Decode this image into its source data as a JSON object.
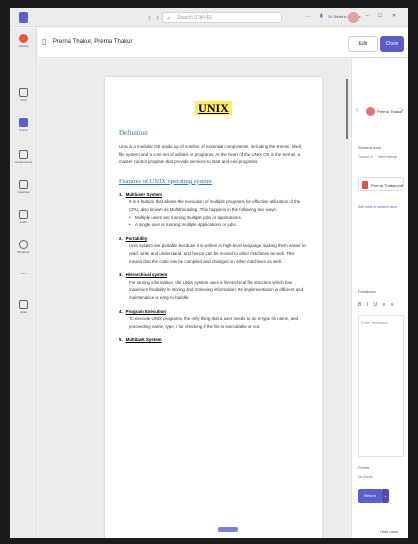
{
  "colors": {
    "accent": "#5b5fc7",
    "heading_blue": "#2e74b5",
    "highlight": "#ffeb6b"
  },
  "topbar": {
    "search_placeholder": "Search (Ctrl+E)",
    "org_label": "St. Bede's College",
    "more_label": "...",
    "back_arrow": "‹",
    "forward_arrow": "›"
  },
  "rail": {
    "items": [
      {
        "label": "Activity",
        "icon": "bell-icon"
      },
      {
        "label": "Chat",
        "icon": "chat-icon"
      },
      {
        "label": "Teams",
        "icon": "teams-icon",
        "active": true
      },
      {
        "label": "Assignments",
        "icon": "assignments-icon"
      },
      {
        "label": "Calendar",
        "icon": "calendar-icon"
      },
      {
        "label": "Calls",
        "icon": "phone-icon"
      },
      {
        "label": "OneDrive",
        "icon": "cloud-icon"
      },
      {
        "label": "...",
        "icon": "more-icon"
      },
      {
        "label": "Apps",
        "icon": "apps-icon"
      }
    ]
  },
  "header": {
    "title": "Prerna Thakur, Prerna Thakur",
    "edit_label": "Edit",
    "close_label": "Close"
  },
  "document": {
    "title": "UNIX",
    "definition_heading": "Definition",
    "definition_text": "Unix is a modular OS made up of number of essential components, including the Kernel, shell, file system and a core set of utilities or programs. At the heart of the UNIX OS is the Kernel, a master control program that provide services to start and end programs.",
    "features_heading": "Features of UNIX operating system",
    "features": [
      {
        "num": "1.",
        "title": "Multiuser System",
        "body": "It is a feature that allows the execution of multiple programs for effective utilization of the CPU, also known as Multithreading. This happens in the following two ways:",
        "bullets": [
          "Multiple users are running multiple jobs or applications.",
          "A single user is running multiple applications or jobs."
        ]
      },
      {
        "num": "2.",
        "title": "Portability",
        "body": "Unix system are portable because it is written in high-level language making them easier to read, write and understand, and hence can be moved to other machines as well. This means that the code can be compiled and changed on other machines as well.",
        "bullets": []
      },
      {
        "num": "3.",
        "title": "Hierarchical system",
        "body": "For storing information, the UNIX system uses a hierarchical file structure which has maximum flexibility in storing and retrieving information. Its implementation is efficient and maintenance is easy to handle.",
        "bullets": []
      },
      {
        "num": "4.",
        "title": "Program Execution",
        "body": "To execute UNIX programs, the only thing that a user needs to do is type its name, and proceeding name, type, / for checking if the file is executable or not.",
        "bullets": []
      },
      {
        "num": "5.",
        "title": "Multitask System",
        "body": "",
        "bullets": []
      }
    ]
  },
  "rpane": {
    "student_name": "Prerna Thakur",
    "student_work_label": "Student work",
    "turned_in_label": "Turned in",
    "view_history_label": "View history",
    "file_name": "Prerna Thakur.pdf",
    "see_in_view_label": "See edits in student view",
    "feedback_label": "Feedback",
    "feedback_toolbar": "B I U ≡ ≡",
    "feedback_placeholder": "Enter feedback",
    "points_label": "Points",
    "points_value": "No points",
    "return_label": "Return",
    "hide_pane_label": "Hide pane"
  }
}
